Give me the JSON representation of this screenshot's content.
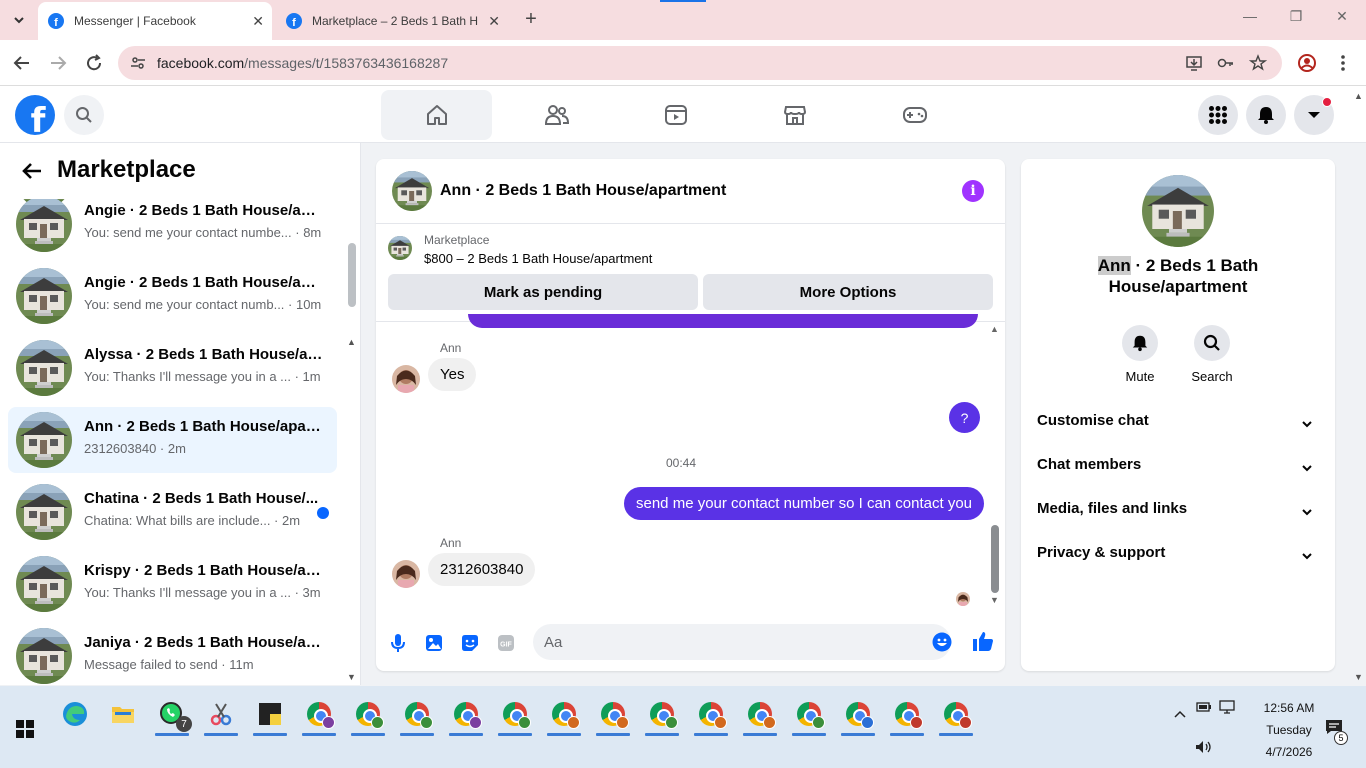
{
  "browser": {
    "tabs": [
      {
        "title": "Messenger | Facebook",
        "active": true
      },
      {
        "title": "Marketplace – 2 Beds 1 Bath Ho",
        "active": false
      }
    ],
    "url_host": "facebook.com",
    "url_path": "/messages/t/1583763436168287"
  },
  "colors": {
    "fb_blue": "#1877f2",
    "selected_bg": "#ebf5ff",
    "outgoing_bubble": "#5a32e6",
    "unread_dot": "#0866ff"
  },
  "sidebar": {
    "title": "Marketplace",
    "conversations": [
      {
        "name": "Angie · 2 Beds 1 Bath House/apa...",
        "preview": "You: send me your contact numbe... · 8m",
        "selected": false,
        "unread": false
      },
      {
        "name": "Angie · 2 Beds 1 Bath House/apa...",
        "preview": "You: send me your contact numb... · 10m",
        "selected": false,
        "unread": false
      },
      {
        "name": "Alyssa · 2 Beds 1 Bath House/apa...",
        "preview": "You: Thanks I'll message you in a ... · 1m",
        "selected": false,
        "unread": false
      },
      {
        "name": "Ann · 2 Beds 1 Bath House/apart...",
        "preview": "2312603840 · 2m",
        "selected": true,
        "unread": false
      },
      {
        "name": "Chatina · 2 Beds 1 Bath House/...",
        "preview": "Chatina: What bills are include... · 2m",
        "selected": false,
        "unread": true
      },
      {
        "name": "Krispy · 2 Beds 1 Bath House/apa...",
        "preview": "You: Thanks I'll message you in a ... · 3m",
        "selected": false,
        "unread": false
      },
      {
        "name": "Janiya · 2 Beds 1 Bath House/ap...",
        "preview": "Message failed to send · 11m",
        "selected": false,
        "unread": false
      }
    ]
  },
  "chat": {
    "header_name": "Ann · 2 Beds 1 Bath House/apartment",
    "marketplace_label": "Marketplace",
    "listing_title": "$800 – 2 Beds 1 Bath House/apartment",
    "mark_pending_label": "Mark as pending",
    "more_options_label": "More Options",
    "messages": {
      "m1_sender": "Ann",
      "m1_text": "Yes",
      "m2_text": "?",
      "timestamp": "00:44",
      "m3_text": "send me your contact number so I can contact you",
      "m4_sender": "Ann",
      "m4_text": "2312603840"
    },
    "composer_placeholder": "Aa"
  },
  "info_panel": {
    "name_highlight": "Ann",
    "title_rest_line1": " · 2 Beds 1 Bath",
    "title_line2": "House/apartment",
    "mute_label": "Mute",
    "search_label": "Search",
    "sections": [
      "Customise chat",
      "Chat members",
      "Media, files and links",
      "Privacy & support"
    ]
  },
  "taskbar": {
    "whatsapp_badge": "7",
    "time": "12:56 AM",
    "day": "Tuesday",
    "date": "4/7/2026",
    "notifications": "5",
    "chrome_profile_colors": [
      "#7b3fa0",
      "#3b8f3b",
      "#3b8f3b",
      "#7b3fa0",
      "#3b8f3b",
      "#d2691e",
      "#d2691e",
      "#3b8f3b",
      "#d2691e",
      "#d2691e",
      "#3b8f3b",
      "#2a6fd6",
      "#c0392b",
      "#c0392b"
    ]
  }
}
